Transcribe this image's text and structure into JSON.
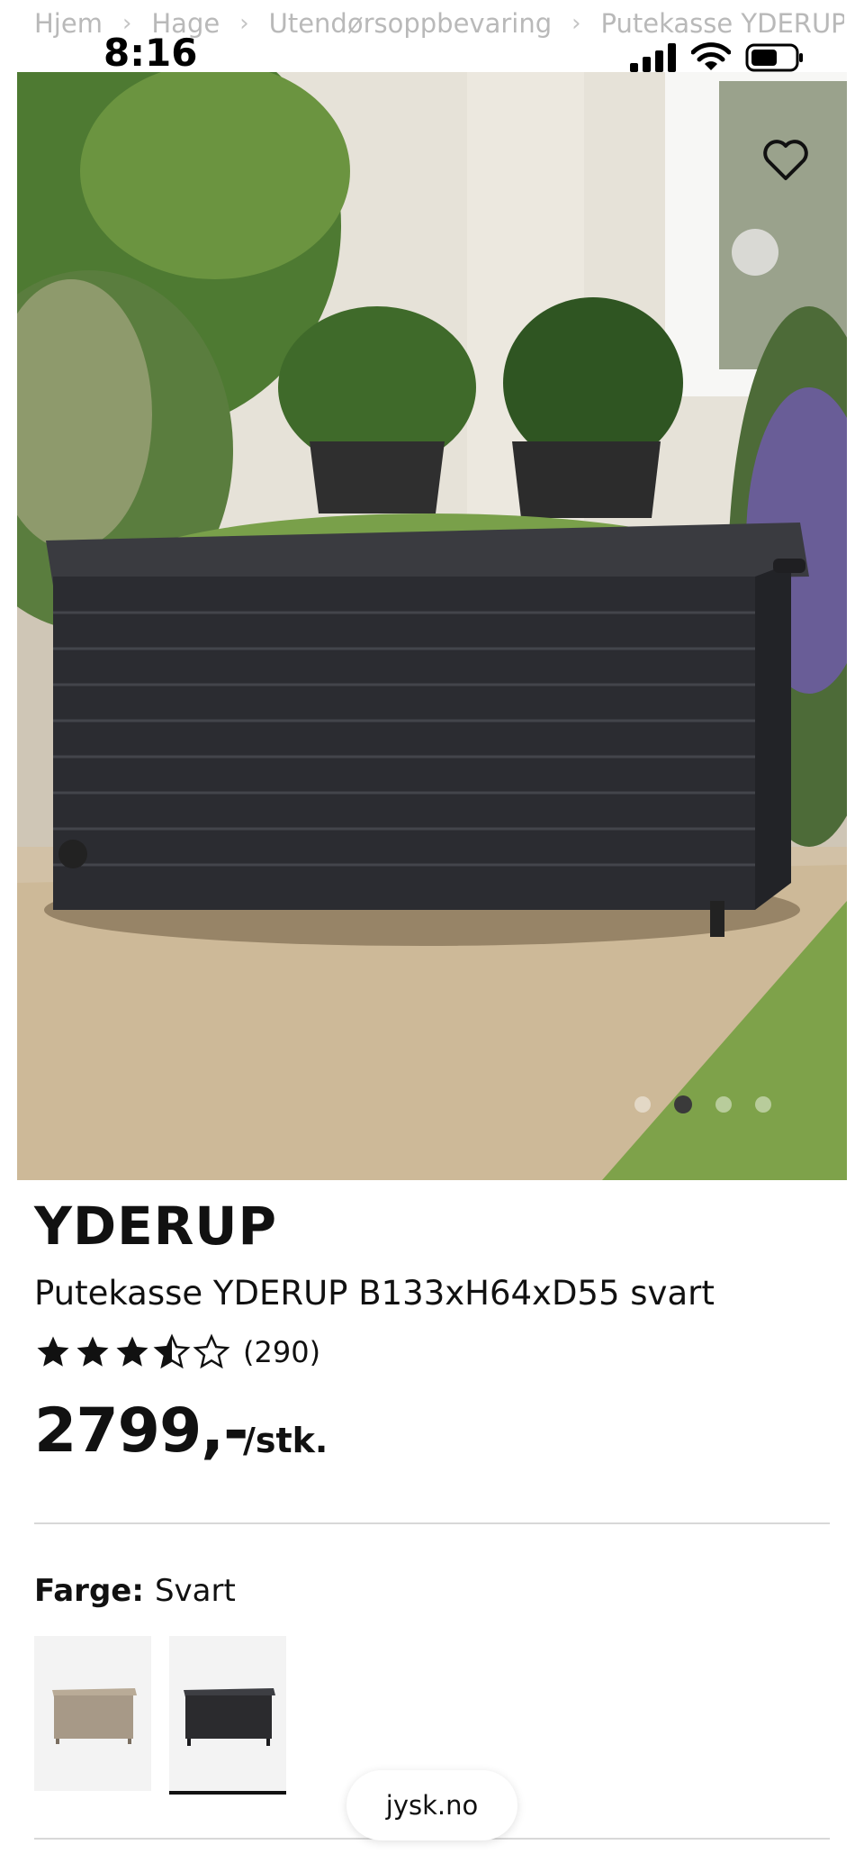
{
  "status_bar": {
    "time": "8:16"
  },
  "breadcrumb": {
    "items": [
      "Hjem",
      "Hage",
      "Utendørsoppbevaring",
      "Putekasse YDERUP B"
    ]
  },
  "gallery": {
    "slide_count": 4,
    "active_index": 1
  },
  "product": {
    "brand": "YDERUP",
    "name": "Putekasse YDERUP B133xH64xD55 svart",
    "rating": 3.5,
    "rating_max": 5,
    "review_count": "(290)",
    "price": "2799,-",
    "unit": "/stk."
  },
  "color_selector": {
    "label": "Farge:",
    "value": "Svart",
    "options": [
      {
        "name": "Beige",
        "color": "#a79987",
        "selected": false
      },
      {
        "name": "Svart",
        "color": "#2b2b2e",
        "selected": true
      }
    ]
  },
  "browser": {
    "url": "jysk.no"
  },
  "colors": {
    "text": "#111111",
    "divider": "#d8d8d8",
    "muted": "#b9b9b9"
  }
}
